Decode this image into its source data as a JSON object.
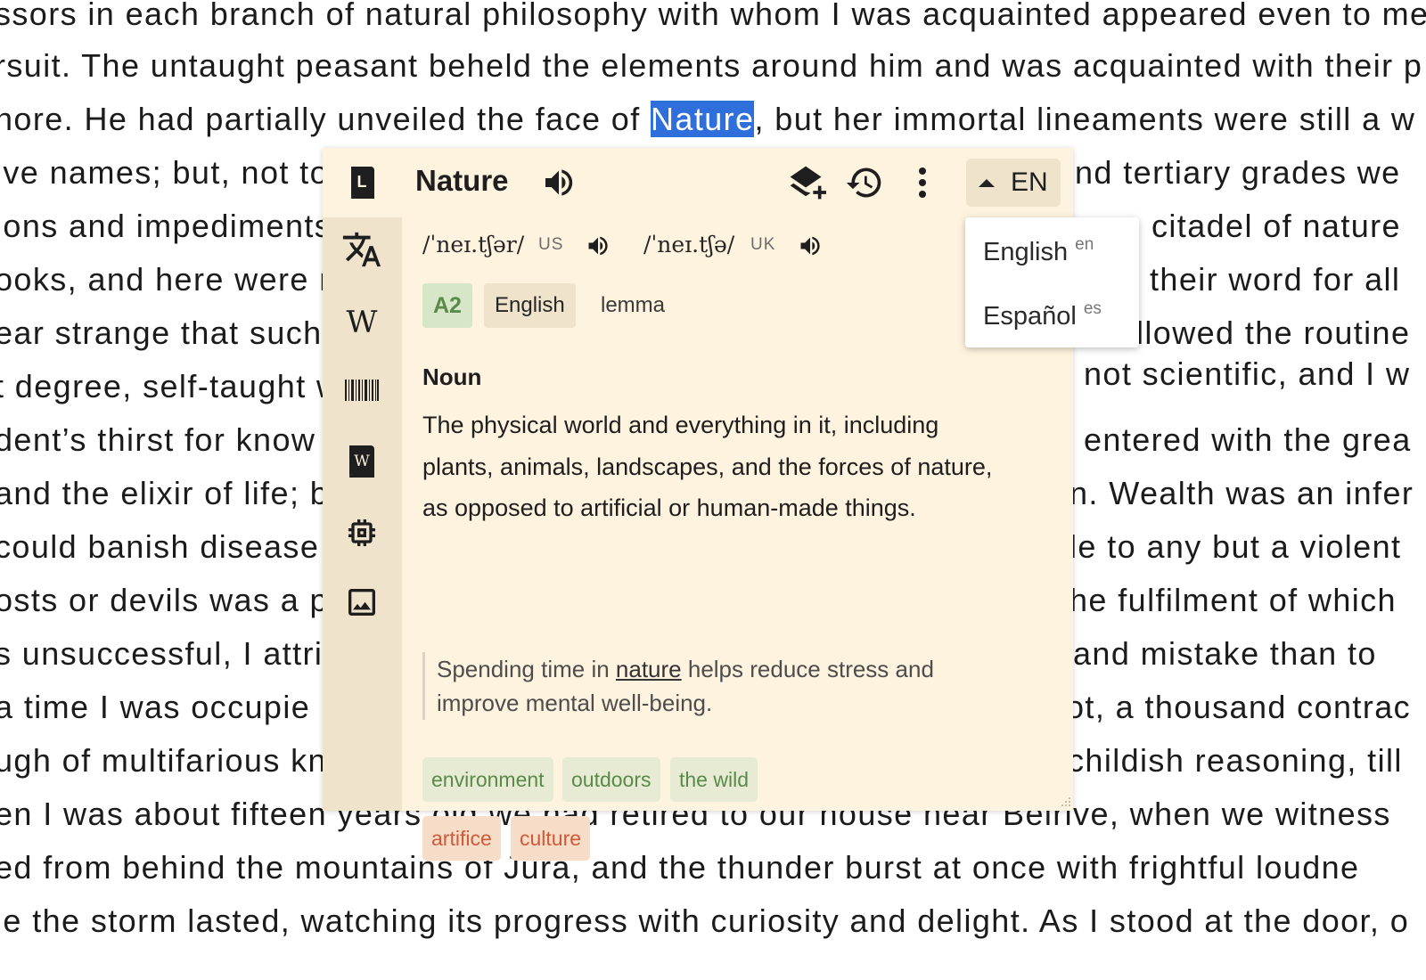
{
  "document": {
    "lines": [
      "ssors in each branch of natural philosophy with whom I was acquainted appeared even to me",
      "rsuit. The untaught peasant beheld the elements around him and was acquainted with their p",
      "nore. He had partially unveiled the face of ",
      "ive names; but, not to",
      "ions and impediments",
      "ooks, and here were m",
      "ear strange that such",
      "t degree, self-taught w",
      "dent’s thirst for know",
      "and the elixir of life; bu",
      "could banish disease f",
      "osts or devils was a pro",
      "s unsuccessful, I attrib",
      " a time I was occupie",
      "ugh of multifarious kn",
      "en I was about fifteen years old we had retired to our house near Belrive, when we witness",
      "ed from behind the mountains of Jura, and the thunder burst at once with frightful loudne",
      "le the storm lasted, watching its progress with curiosity and delight. As I stood at the door, o"
    ],
    "line3_highlight": "Nature",
    "line3_rest": ", but her immortal lineaments were still a w",
    "right_fragments": [
      "nd tertiary grades we",
      "citadel of nature",
      "their word for all",
      "llowed the routine",
      "not scientific, and I w",
      "entered with the grea",
      "n. Wealth was an infer",
      "le to any but a violent",
      "he fulfilment of which",
      "and mistake than to",
      "ot, a thousand contrac",
      "childish reasoning, till"
    ]
  },
  "popup": {
    "word": "Nature",
    "lang_code": "EN",
    "pronunciations": [
      {
        "ipa": "/ˈneɪ.tʃər/",
        "region": "US"
      },
      {
        "ipa": "/ˈneɪ.tʃə/",
        "region": "UK"
      }
    ],
    "level": "A2",
    "language": "English",
    "form": "lemma",
    "part_of_speech": "Noun",
    "definition": "The physical world and everything in it, including plants, animals, landscapes, and the forces of nature, as opposed to artificial or human-made things.",
    "example_before": "Spending time in ",
    "example_keyword": "nature",
    "example_after": " helps reduce stress and improve mental well-being.",
    "synonyms": [
      "environment",
      "outdoors",
      "the wild"
    ],
    "antonyms": [
      "artifice",
      "culture"
    ],
    "sidebar_icons": [
      "dictionary-icon",
      "translate-icon",
      "wikipedia-icon",
      "barcode-icon",
      "wiktionary-icon",
      "chip-icon",
      "image-icon"
    ],
    "toolbar_icons": [
      "speaker-icon",
      "add-to-deck-icon",
      "history-icon",
      "more-vert-icon"
    ]
  },
  "language_menu": {
    "options": [
      {
        "label": "English",
        "code": "en"
      },
      {
        "label": "Español",
        "code": "es"
      }
    ]
  },
  "colors": {
    "popup_bg": "#fdf3de",
    "sidebar_bg": "#efe3cb",
    "highlight": "#2f6fdc",
    "synonym_text": "#5a8a4a",
    "antonym_text": "#cf5a38"
  }
}
